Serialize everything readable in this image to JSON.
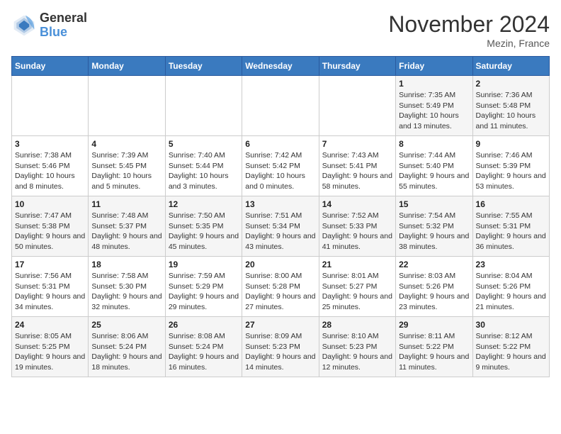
{
  "header": {
    "logo_line1": "General",
    "logo_line2": "Blue",
    "month_title": "November 2024",
    "location": "Mezin, France"
  },
  "weekdays": [
    "Sunday",
    "Monday",
    "Tuesday",
    "Wednesday",
    "Thursday",
    "Friday",
    "Saturday"
  ],
  "weeks": [
    [
      {
        "day": "",
        "info": ""
      },
      {
        "day": "",
        "info": ""
      },
      {
        "day": "",
        "info": ""
      },
      {
        "day": "",
        "info": ""
      },
      {
        "day": "",
        "info": ""
      },
      {
        "day": "1",
        "info": "Sunrise: 7:35 AM\nSunset: 5:49 PM\nDaylight: 10 hours and 13 minutes."
      },
      {
        "day": "2",
        "info": "Sunrise: 7:36 AM\nSunset: 5:48 PM\nDaylight: 10 hours and 11 minutes."
      }
    ],
    [
      {
        "day": "3",
        "info": "Sunrise: 7:38 AM\nSunset: 5:46 PM\nDaylight: 10 hours and 8 minutes."
      },
      {
        "day": "4",
        "info": "Sunrise: 7:39 AM\nSunset: 5:45 PM\nDaylight: 10 hours and 5 minutes."
      },
      {
        "day": "5",
        "info": "Sunrise: 7:40 AM\nSunset: 5:44 PM\nDaylight: 10 hours and 3 minutes."
      },
      {
        "day": "6",
        "info": "Sunrise: 7:42 AM\nSunset: 5:42 PM\nDaylight: 10 hours and 0 minutes."
      },
      {
        "day": "7",
        "info": "Sunrise: 7:43 AM\nSunset: 5:41 PM\nDaylight: 9 hours and 58 minutes."
      },
      {
        "day": "8",
        "info": "Sunrise: 7:44 AM\nSunset: 5:40 PM\nDaylight: 9 hours and 55 minutes."
      },
      {
        "day": "9",
        "info": "Sunrise: 7:46 AM\nSunset: 5:39 PM\nDaylight: 9 hours and 53 minutes."
      }
    ],
    [
      {
        "day": "10",
        "info": "Sunrise: 7:47 AM\nSunset: 5:38 PM\nDaylight: 9 hours and 50 minutes."
      },
      {
        "day": "11",
        "info": "Sunrise: 7:48 AM\nSunset: 5:37 PM\nDaylight: 9 hours and 48 minutes."
      },
      {
        "day": "12",
        "info": "Sunrise: 7:50 AM\nSunset: 5:35 PM\nDaylight: 9 hours and 45 minutes."
      },
      {
        "day": "13",
        "info": "Sunrise: 7:51 AM\nSunset: 5:34 PM\nDaylight: 9 hours and 43 minutes."
      },
      {
        "day": "14",
        "info": "Sunrise: 7:52 AM\nSunset: 5:33 PM\nDaylight: 9 hours and 41 minutes."
      },
      {
        "day": "15",
        "info": "Sunrise: 7:54 AM\nSunset: 5:32 PM\nDaylight: 9 hours and 38 minutes."
      },
      {
        "day": "16",
        "info": "Sunrise: 7:55 AM\nSunset: 5:31 PM\nDaylight: 9 hours and 36 minutes."
      }
    ],
    [
      {
        "day": "17",
        "info": "Sunrise: 7:56 AM\nSunset: 5:31 PM\nDaylight: 9 hours and 34 minutes."
      },
      {
        "day": "18",
        "info": "Sunrise: 7:58 AM\nSunset: 5:30 PM\nDaylight: 9 hours and 32 minutes."
      },
      {
        "day": "19",
        "info": "Sunrise: 7:59 AM\nSunset: 5:29 PM\nDaylight: 9 hours and 29 minutes."
      },
      {
        "day": "20",
        "info": "Sunrise: 8:00 AM\nSunset: 5:28 PM\nDaylight: 9 hours and 27 minutes."
      },
      {
        "day": "21",
        "info": "Sunrise: 8:01 AM\nSunset: 5:27 PM\nDaylight: 9 hours and 25 minutes."
      },
      {
        "day": "22",
        "info": "Sunrise: 8:03 AM\nSunset: 5:26 PM\nDaylight: 9 hours and 23 minutes."
      },
      {
        "day": "23",
        "info": "Sunrise: 8:04 AM\nSunset: 5:26 PM\nDaylight: 9 hours and 21 minutes."
      }
    ],
    [
      {
        "day": "24",
        "info": "Sunrise: 8:05 AM\nSunset: 5:25 PM\nDaylight: 9 hours and 19 minutes."
      },
      {
        "day": "25",
        "info": "Sunrise: 8:06 AM\nSunset: 5:24 PM\nDaylight: 9 hours and 18 minutes."
      },
      {
        "day": "26",
        "info": "Sunrise: 8:08 AM\nSunset: 5:24 PM\nDaylight: 9 hours and 16 minutes."
      },
      {
        "day": "27",
        "info": "Sunrise: 8:09 AM\nSunset: 5:23 PM\nDaylight: 9 hours and 14 minutes."
      },
      {
        "day": "28",
        "info": "Sunrise: 8:10 AM\nSunset: 5:23 PM\nDaylight: 9 hours and 12 minutes."
      },
      {
        "day": "29",
        "info": "Sunrise: 8:11 AM\nSunset: 5:22 PM\nDaylight: 9 hours and 11 minutes."
      },
      {
        "day": "30",
        "info": "Sunrise: 8:12 AM\nSunset: 5:22 PM\nDaylight: 9 hours and 9 minutes."
      }
    ]
  ]
}
